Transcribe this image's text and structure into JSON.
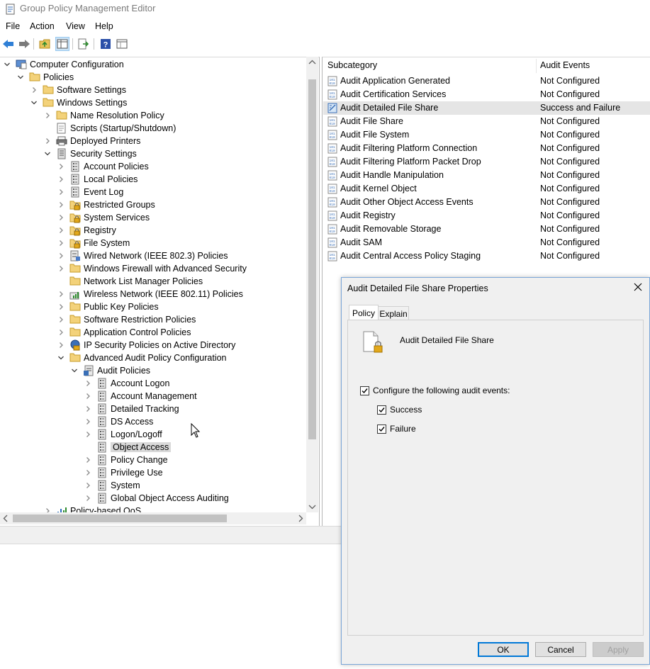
{
  "window": {
    "title": "Group Policy Management Editor"
  },
  "menu": [
    "File",
    "Action",
    "View",
    "Help"
  ],
  "toolbar": {
    "icons": [
      "back-arrow-icon",
      "forward-arrow-icon",
      "up-folder-icon",
      "show-hide-tree-icon",
      "export-list-icon",
      "help-icon",
      "properties-icon"
    ]
  },
  "tree": {
    "items": [
      {
        "label": "Computer Configuration",
        "level": 0,
        "exp": "open",
        "icon": "computer"
      },
      {
        "label": "Policies",
        "level": 1,
        "exp": "open",
        "icon": "folder"
      },
      {
        "label": "Software Settings",
        "level": 2,
        "exp": "closed",
        "icon": "folder"
      },
      {
        "label": "Windows Settings",
        "level": 2,
        "exp": "open",
        "icon": "folder"
      },
      {
        "label": "Name Resolution Policy",
        "level": 3,
        "exp": "closed",
        "icon": "folder"
      },
      {
        "label": "Scripts (Startup/Shutdown)",
        "level": 3,
        "exp": "none",
        "icon": "script"
      },
      {
        "label": "Deployed Printers",
        "level": 3,
        "exp": "closed",
        "icon": "printer"
      },
      {
        "label": "Security Settings",
        "level": 3,
        "exp": "open",
        "icon": "security"
      },
      {
        "label": "Account Policies",
        "level": 4,
        "exp": "closed",
        "icon": "policy"
      },
      {
        "label": "Local Policies",
        "level": 4,
        "exp": "closed",
        "icon": "policy"
      },
      {
        "label": "Event Log",
        "level": 4,
        "exp": "closed",
        "icon": "policy"
      },
      {
        "label": "Restricted Groups",
        "level": 4,
        "exp": "closed",
        "icon": "lockfolder"
      },
      {
        "label": "System Services",
        "level": 4,
        "exp": "closed",
        "icon": "lockfolder"
      },
      {
        "label": "Registry",
        "level": 4,
        "exp": "closed",
        "icon": "lockfolder"
      },
      {
        "label": "File System",
        "level": 4,
        "exp": "closed",
        "icon": "lockfolder"
      },
      {
        "label": "Wired Network (IEEE 802.3) Policies",
        "level": 4,
        "exp": "closed",
        "icon": "network"
      },
      {
        "label": "Windows Firewall with Advanced Security",
        "level": 4,
        "exp": "closed",
        "icon": "folder"
      },
      {
        "label": "Network List Manager Policies",
        "level": 4,
        "exp": "none",
        "icon": "folder"
      },
      {
        "label": "Wireless Network (IEEE 802.11) Policies",
        "level": 4,
        "exp": "closed",
        "icon": "wireless"
      },
      {
        "label": "Public Key Policies",
        "level": 4,
        "exp": "closed",
        "icon": "folder"
      },
      {
        "label": "Software Restriction Policies",
        "level": 4,
        "exp": "closed",
        "icon": "folder"
      },
      {
        "label": "Application Control Policies",
        "level": 4,
        "exp": "closed",
        "icon": "folder"
      },
      {
        "label": "IP Security Policies on Active Directory",
        "level": 4,
        "exp": "closed",
        "icon": "ipsec"
      },
      {
        "label": "Advanced Audit Policy Configuration",
        "level": 4,
        "exp": "open",
        "icon": "folder"
      },
      {
        "label": "Audit Policies",
        "level": 5,
        "exp": "open",
        "icon": "audit"
      },
      {
        "label": "Account Logon",
        "level": 6,
        "exp": "closed",
        "icon": "policy"
      },
      {
        "label": "Account Management",
        "level": 6,
        "exp": "closed",
        "icon": "policy"
      },
      {
        "label": "Detailed Tracking",
        "level": 6,
        "exp": "closed",
        "icon": "policy"
      },
      {
        "label": "DS Access",
        "level": 6,
        "exp": "closed",
        "icon": "policy"
      },
      {
        "label": "Logon/Logoff",
        "level": 6,
        "exp": "closed",
        "icon": "policy"
      },
      {
        "label": "Object Access",
        "level": 6,
        "exp": "none",
        "icon": "policy",
        "selected": true
      },
      {
        "label": "Policy Change",
        "level": 6,
        "exp": "closed",
        "icon": "policy"
      },
      {
        "label": "Privilege Use",
        "level": 6,
        "exp": "closed",
        "icon": "policy"
      },
      {
        "label": "System",
        "level": 6,
        "exp": "closed",
        "icon": "policy"
      },
      {
        "label": "Global Object Access Auditing",
        "level": 6,
        "exp": "closed",
        "icon": "policy"
      },
      {
        "label": "Policy-based QoS",
        "level": 3,
        "exp": "closed",
        "icon": "chart"
      }
    ]
  },
  "list": {
    "headers": {
      "subcategory": "Subcategory",
      "audit_events": "Audit Events"
    },
    "rows": [
      {
        "sub": "Audit Application Generated",
        "ev": "Not Configured"
      },
      {
        "sub": "Audit Certification Services",
        "ev": "Not Configured"
      },
      {
        "sub": "Audit Detailed File Share",
        "ev": "Success and Failure",
        "selected": true
      },
      {
        "sub": "Audit File Share",
        "ev": "Not Configured"
      },
      {
        "sub": "Audit File System",
        "ev": "Not Configured"
      },
      {
        "sub": "Audit Filtering Platform Connection",
        "ev": "Not Configured"
      },
      {
        "sub": "Audit Filtering Platform Packet Drop",
        "ev": "Not Configured"
      },
      {
        "sub": "Audit Handle Manipulation",
        "ev": "Not Configured"
      },
      {
        "sub": "Audit Kernel Object",
        "ev": "Not Configured"
      },
      {
        "sub": "Audit Other Object Access Events",
        "ev": "Not Configured"
      },
      {
        "sub": "Audit Registry",
        "ev": "Not Configured"
      },
      {
        "sub": "Audit Removable Storage",
        "ev": "Not Configured"
      },
      {
        "sub": "Audit SAM",
        "ev": "Not Configured"
      },
      {
        "sub": "Audit Central Access Policy Staging",
        "ev": "Not Configured"
      }
    ]
  },
  "dialog": {
    "title": "Audit Detailed File Share Properties",
    "tabs": {
      "policy": "Policy",
      "explain": "Explain"
    },
    "policy_name": "Audit Detailed File Share",
    "configure_label": "Configure the following audit events:",
    "success_label": "Success",
    "failure_label": "Failure",
    "configure_checked": true,
    "success_checked": true,
    "failure_checked": true,
    "buttons": {
      "ok": "OK",
      "cancel": "Cancel",
      "apply": "Apply"
    }
  }
}
